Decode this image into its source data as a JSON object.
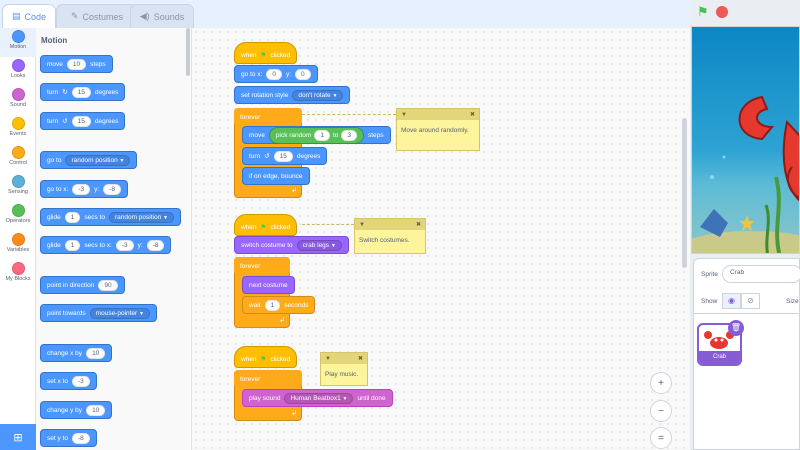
{
  "tabs": [
    {
      "label": "Code",
      "icon": "code-icon"
    },
    {
      "label": "Costumes",
      "icon": "brush-icon"
    },
    {
      "label": "Sounds",
      "icon": "speaker-icon"
    }
  ],
  "categories": [
    {
      "label": "Motion",
      "color": "#4c97ff"
    },
    {
      "label": "Looks",
      "color": "#9966ff"
    },
    {
      "label": "Sound",
      "color": "#cf63cf"
    },
    {
      "label": "Events",
      "color": "#ffbf00"
    },
    {
      "label": "Control",
      "color": "#ffab19"
    },
    {
      "label": "Sensing",
      "color": "#5cb1d6"
    },
    {
      "label": "Operators",
      "color": "#59c059"
    },
    {
      "label": "Variables",
      "color": "#ff8c1a"
    },
    {
      "label": "My Blocks",
      "color": "#ff6680"
    }
  ],
  "palette": {
    "title": "Motion",
    "move": {
      "label": "move",
      "value": "10",
      "suffix": "steps"
    },
    "turn_right": {
      "label": "turn",
      "icon": "rotate-right-icon",
      "value": "15",
      "suffix": "degrees"
    },
    "turn_left": {
      "label": "turn",
      "icon": "rotate-left-icon",
      "value": "15",
      "suffix": "degrees"
    },
    "go_to": {
      "label": "go to",
      "option": "random position"
    },
    "go_to_xy": {
      "label": "go to x:",
      "x": "-3",
      "ylabel": "y:",
      "y": "-8"
    },
    "glide_to": {
      "label": "glide",
      "secs": "1",
      "mid": "secs to",
      "option": "random position"
    },
    "glide_xy": {
      "label": "glide",
      "secs": "1",
      "mid": "secs to x:",
      "x": "-3",
      "ylabel": "y:",
      "y": "-8"
    },
    "point_dir": {
      "label": "point in direction",
      "value": "90"
    },
    "point_towards": {
      "label": "point towards",
      "option": "mouse-pointer"
    },
    "change_x": {
      "label": "change x by",
      "value": "10"
    },
    "set_x": {
      "label": "set x to",
      "value": "-3"
    },
    "change_y": {
      "label": "change y by",
      "value": "10"
    },
    "set_y": {
      "label": "set y to",
      "value": "-8"
    }
  },
  "script1": {
    "hat": {
      "when": "when",
      "clicked": "clicked"
    },
    "goto": {
      "label": "go to x:",
      "x": "0",
      "ylabel": "y:",
      "y": "0"
    },
    "rotation": {
      "label": "set rotation style",
      "option": "don't rotate"
    },
    "forever": "forever",
    "move": {
      "label": "move",
      "op": "pick random",
      "from": "1",
      "to_label": "to",
      "to": "3",
      "suffix": "steps"
    },
    "turn": {
      "label": "turn",
      "value": "15",
      "suffix": "degrees"
    },
    "bounce": "if on edge, bounce",
    "note": "Move around randomly."
  },
  "script2": {
    "hat": {
      "when": "when",
      "clicked": "clicked"
    },
    "switch": {
      "label": "switch costume to",
      "option": "crab legs"
    },
    "forever": "forever",
    "next": "next costume",
    "wait": {
      "label": "wait",
      "value": "1",
      "suffix": "seconds"
    },
    "note": "Switch costumes."
  },
  "script3": {
    "hat": {
      "when": "when",
      "clicked": "clicked"
    },
    "forever": "forever",
    "play": {
      "label": "play sound",
      "option": "Human Beatbox1",
      "suffix": "until done"
    },
    "note": "Play music."
  },
  "zoom": {
    "in": "+",
    "out": "−",
    "reset": "="
  },
  "sprite_info": {
    "sprite_label": "Sprite",
    "sprite_name": "Crab",
    "show_label": "Show",
    "size_label": "Size"
  },
  "sprite_list": [
    {
      "name": "Crab"
    }
  ],
  "icons": {
    "flag": "green-flag-icon",
    "stop": "stop-icon"
  }
}
